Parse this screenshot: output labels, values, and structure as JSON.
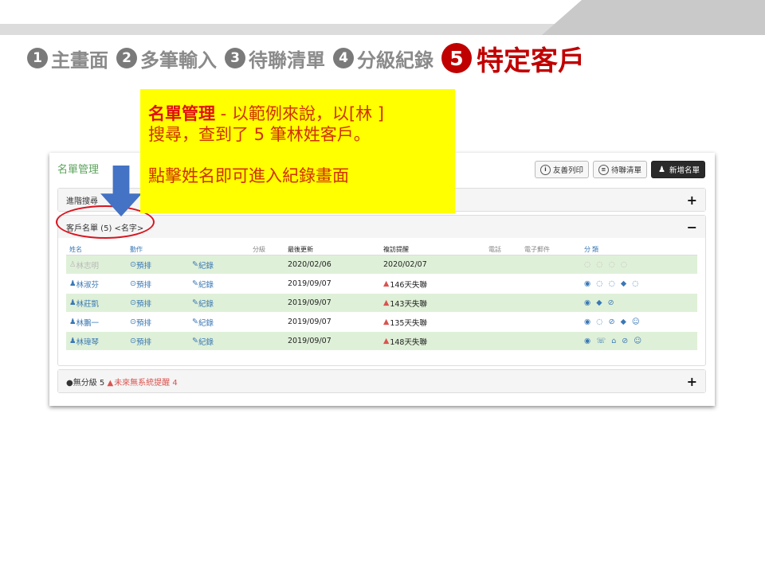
{
  "header": {
    "steps": [
      {
        "num": "1",
        "label": "主畫面"
      },
      {
        "num": "2",
        "label": "多筆輸入"
      },
      {
        "num": "3",
        "label": "待聯清單"
      },
      {
        "num": "4",
        "label": "分級紀錄"
      },
      {
        "num": "5",
        "label": "特定客戶"
      }
    ]
  },
  "note": {
    "title": "名單管理",
    "line1": " - 以範例來說，以[林 ]",
    "line2": "搜尋，查到了 5 筆林姓客戶。",
    "line3": "點擊姓名即可進入紀錄畫面"
  },
  "screen": {
    "title": "名單管理",
    "buttons": {
      "print": "友善列印",
      "pending": "待聯清單",
      "add": "新增名單"
    },
    "advanced_search": "進階搜尋",
    "list_title": "客戶名單 (5) <名字>",
    "columns": [
      "姓名",
      "動作",
      "",
      "分級",
      "最後更新",
      "複訪提醒",
      "電話",
      "電子郵件",
      "分類"
    ],
    "rows": [
      {
        "name": "林志明",
        "action": "預排",
        "record": "紀錄",
        "grade": "",
        "updated": "2020/02/06",
        "reminder": "2020/02/07",
        "warn": false,
        "cls": "◌ ◌ ◌ ◌",
        "faded": true
      },
      {
        "name": "林淑芬",
        "action": "預排",
        "record": "紀錄",
        "grade": "",
        "updated": "2019/09/07",
        "reminder": "146天失聯",
        "warn": true,
        "cls": "◉ ◌ ◌ ◆ ◌",
        "faded": false
      },
      {
        "name": "林莊凱",
        "action": "預排",
        "record": "紀錄",
        "grade": "",
        "updated": "2019/09/07",
        "reminder": "143天失聯",
        "warn": true,
        "cls": "◉ ◆ ⊘",
        "faded": false
      },
      {
        "name": "林鵬一",
        "action": "預排",
        "record": "紀錄",
        "grade": "",
        "updated": "2019/09/07",
        "reminder": "135天失聯",
        "warn": true,
        "cls": "◉ ◌ ⊘ ◆ ☺",
        "faded": false
      },
      {
        "name": "林瑋琴",
        "action": "預排",
        "record": "紀錄",
        "grade": "",
        "updated": "2019/09/07",
        "reminder": "148天失聯",
        "warn": true,
        "cls": "◉ ☏ ⌂ ⊘ ☺",
        "faded": false
      }
    ],
    "unclassified": {
      "label": "無分級",
      "count": "5",
      "future_label": "未來無系統提醒",
      "future_count": "4"
    }
  },
  "colors": {
    "accent_red": "#c00000",
    "note_bg": "#ffff00",
    "link_blue": "#3a78b5",
    "row_green": "#dff0d8",
    "arrow_blue": "#4472c4"
  }
}
